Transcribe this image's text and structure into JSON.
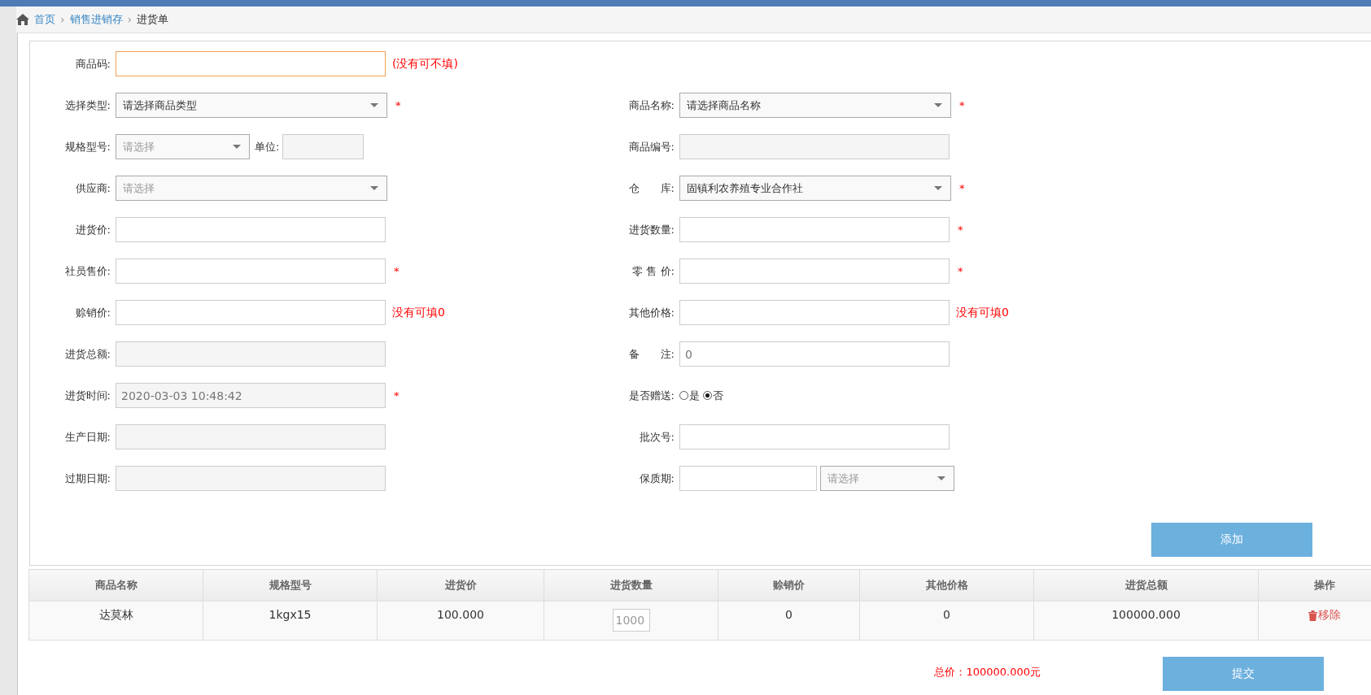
{
  "breadcrumb": [
    {
      "label": "首页",
      "kind": "home"
    },
    {
      "label": "销售进销存",
      "kind": "link",
      "separator": "›"
    },
    {
      "label": "进货单",
      "kind": "current",
      "separator": "›"
    }
  ],
  "form_rows": [
    {
      "left": {
        "label": "商品码:",
        "kind": "input",
        "focused": true,
        "hint": "(没有可不填)"
      }
    },
    {
      "left": {
        "label": "选择类型:",
        "kind": "select",
        "value": "请选择商品类型",
        "required_mark": "*"
      },
      "right": {
        "label": "商品名称:",
        "kind": "select",
        "value": "请选择商品名称",
        "required_mark": "*"
      }
    },
    {
      "left": {
        "label": "规格型号:",
        "kind": "select",
        "placeholder": "请选择",
        "narrow": true,
        "extra": {
          "label": "单位:",
          "kind": "readonly"
        }
      },
      "right": {
        "label": "商品编号:",
        "kind": "readonly"
      }
    },
    {
      "left": {
        "label": "供应商:",
        "kind": "select",
        "placeholder": "请选择"
      },
      "right": {
        "label": "仓　　库:",
        "kind": "select",
        "value": "固镇利农养殖专业合作社",
        "required_mark": "*"
      }
    },
    {
      "left": {
        "label": "进货价:",
        "kind": "input"
      },
      "right": {
        "label": "进货数量:",
        "kind": "input",
        "required_mark": "*"
      }
    },
    {
      "left": {
        "label": "社员售价:",
        "kind": "input",
        "required_mark": "*"
      },
      "right": {
        "label": "零 售 价:",
        "kind": "input",
        "required_mark": "*"
      }
    },
    {
      "left": {
        "label": "赊销价:",
        "kind": "input",
        "hint": "没有可填0"
      },
      "right": {
        "label": "其他价格:",
        "kind": "input",
        "hint": "没有可填0"
      }
    },
    {
      "left": {
        "label": "进货总额:",
        "kind": "readonly"
      },
      "right": {
        "label": "备　　注:",
        "kind": "input",
        "placeholder": "0"
      }
    },
    {
      "left": {
        "label": "进货时间:",
        "kind": "readonly",
        "value": "2020-03-03 10:48:42",
        "required_mark": "*"
      },
      "right": {
        "label": "是否赠送:",
        "kind": "radio",
        "options": [
          {
            "label": "是",
            "selected": false
          },
          {
            "label": "否",
            "selected": true
          }
        ]
      }
    },
    {
      "left": {
        "label": "生产日期:",
        "kind": "readonly"
      },
      "right": {
        "label": "批次号:",
        "kind": "input"
      }
    },
    {
      "left": {
        "label": "过期日期:",
        "kind": "readonly"
      },
      "right": {
        "label": "保质期:",
        "kind": "input_select",
        "select_placeholder": "请选择"
      }
    }
  ],
  "add_button": "添加",
  "table": {
    "columns": [
      "商品名称",
      "规格型号",
      "进货价",
      "进货数量",
      "赊销价",
      "其他价格",
      "进货总额",
      "操作"
    ],
    "rows": [
      {
        "name": "达莫林",
        "spec": "1kgx15",
        "price": "100.000",
        "quantity": "1000",
        "credit_price": "0",
        "other_price": "0",
        "total": "100000.000",
        "action": "移除"
      }
    ]
  },
  "total": "总价：100000.000元",
  "submit_button": "提交"
}
